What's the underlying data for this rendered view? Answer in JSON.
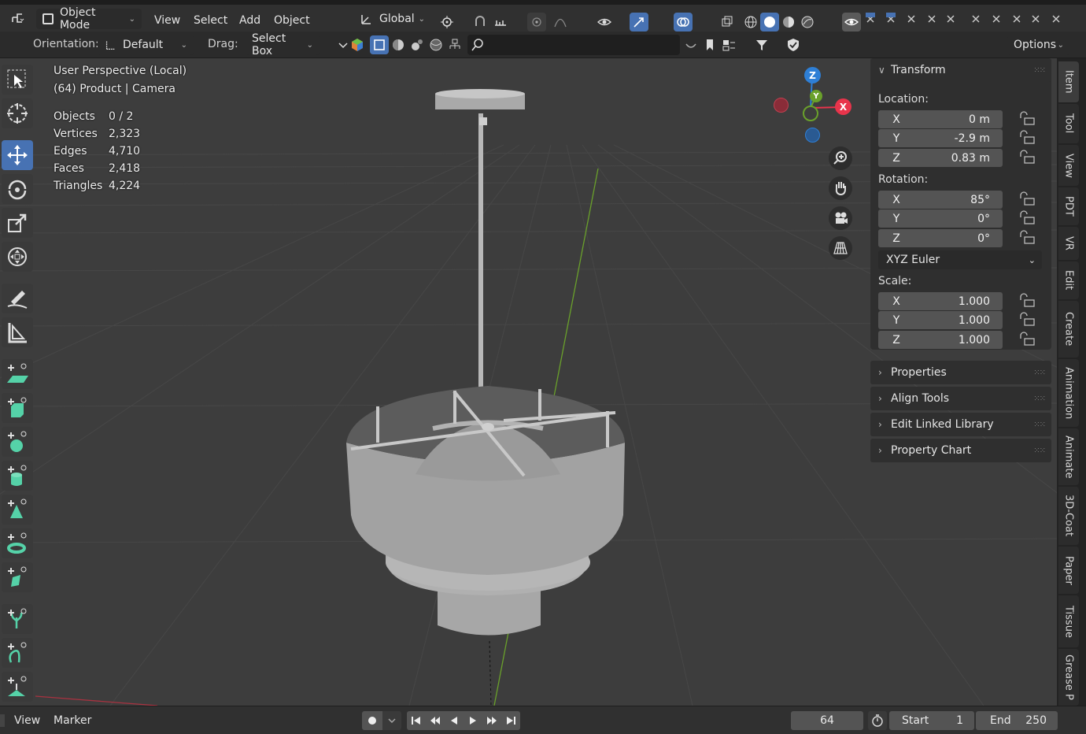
{
  "header": {
    "mode": "Object Mode",
    "menus": [
      "View",
      "Select",
      "Add",
      "Object"
    ],
    "transform_orientation": "Global",
    "orientation_label": "Orientation:",
    "orientation_value": "Default",
    "drag_label": "Drag:",
    "drag_value": "Select Box",
    "options_label": "Options"
  },
  "viewport": {
    "view_name": "User Perspective (Local)",
    "collection": "(64) Product | Camera",
    "stats": [
      {
        "label": "Objects",
        "value": "0 / 2"
      },
      {
        "label": "Vertices",
        "value": "2,323"
      },
      {
        "label": "Edges",
        "value": "4,710"
      },
      {
        "label": "Faces",
        "value": "2,418"
      },
      {
        "label": "Triangles",
        "value": "4,224"
      }
    ],
    "gizmo": {
      "z": "Z",
      "y": "Y",
      "x": "X"
    }
  },
  "npanel": {
    "transform_title": "Transform",
    "location_label": "Location:",
    "location": [
      {
        "axis": "X",
        "value": "0 m"
      },
      {
        "axis": "Y",
        "value": "-2.9 m"
      },
      {
        "axis": "Z",
        "value": "0.83 m"
      }
    ],
    "rotation_label": "Rotation:",
    "rotation": [
      {
        "axis": "X",
        "value": "85°"
      },
      {
        "axis": "Y",
        "value": "0°"
      },
      {
        "axis": "Z",
        "value": "0°"
      }
    ],
    "rotation_mode": "XYZ Euler",
    "scale_label": "Scale:",
    "scale": [
      {
        "axis": "X",
        "value": "1.000"
      },
      {
        "axis": "Y",
        "value": "1.000"
      },
      {
        "axis": "Z",
        "value": "1.000"
      }
    ],
    "collapsed_panels": [
      "Properties",
      "Align Tools",
      "Edit Linked Library",
      "Property Chart"
    ]
  },
  "tabs": [
    "Item",
    "Tool",
    "View",
    "PDT",
    "VR",
    "Edit",
    "Create",
    "Animation",
    "Animate",
    "3D-Coat",
    "Paper",
    "Tissue",
    "Grease P"
  ],
  "timeline": {
    "view": "View",
    "marker": "Marker",
    "current_frame": "64",
    "start_label": "Start",
    "start_value": "1",
    "end_label": "End",
    "end_value": "250"
  },
  "colors": {
    "accent": "#4772b3",
    "axis_x": "#e8344b",
    "axis_y": "#6aa12b",
    "axis_z": "#2e7fd6"
  }
}
